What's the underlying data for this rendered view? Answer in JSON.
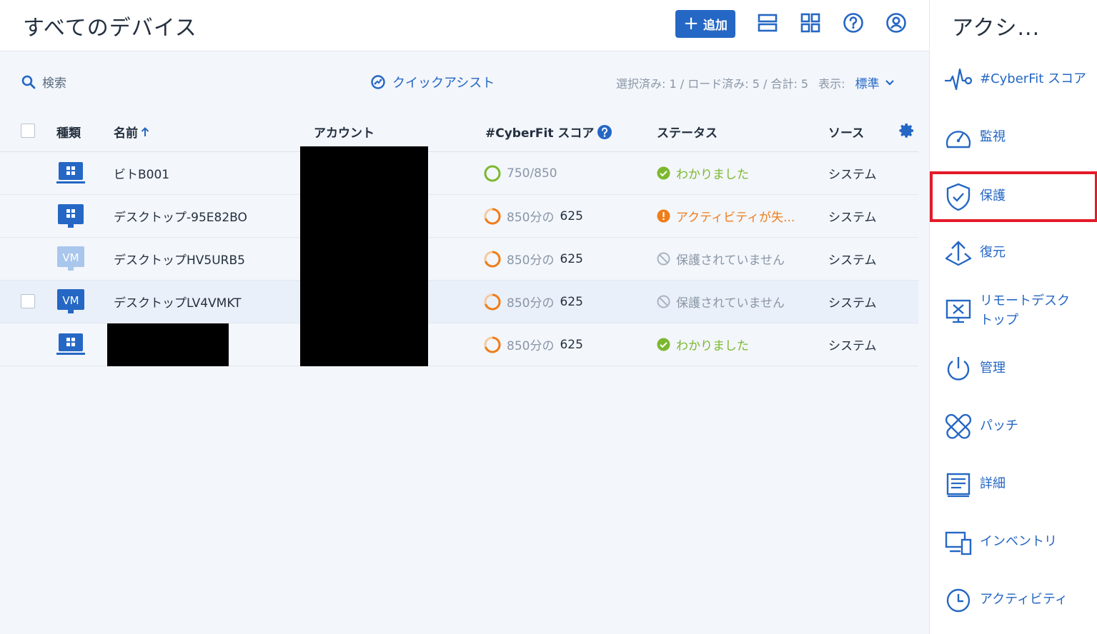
{
  "header": {
    "title": "すべてのデバイス",
    "add_label": "追加",
    "icons": [
      "list-view-icon",
      "grid-view-icon",
      "help-icon",
      "account-icon"
    ]
  },
  "toolbar": {
    "search_label": "検索",
    "quick_assist_label": "クイックアシスト",
    "stats": "選択済み: 1 / ロード済み: 5 / 合計: 5",
    "view_label": "表示:",
    "view_value": "標準"
  },
  "table": {
    "headers": {
      "type": "種類",
      "name": "名前",
      "account": "アカウント",
      "score": "#CyberFit スコア",
      "status": "ステータス",
      "source": "ソース"
    },
    "rows": [
      {
        "icon": "windows-device-icon",
        "name": "ビトB001",
        "score_text": "750/850",
        "score_value": "",
        "score_color": "#7cb82f",
        "status": "わかりました",
        "status_kind": "ok",
        "source": "システム"
      },
      {
        "icon": "windows-device-icon",
        "name": "デスクトップ-95E82BO",
        "score_text": "850分の",
        "score_value": "625",
        "score_color": "#ef7d1a",
        "status": "アクティビティが失...",
        "status_kind": "warn",
        "source": "システム"
      },
      {
        "icon": "vm-light-icon",
        "icon_text": "VM",
        "name": "デスクトップHV5URB5",
        "score_text": "850分の",
        "score_value": "625",
        "score_color": "#ef7d1a",
        "status": "保護されていません",
        "status_kind": "none",
        "source": "システム"
      },
      {
        "icon": "vm-icon",
        "icon_text": "VM",
        "name": "デスクトップLV4VMKT",
        "score_text": "850分の",
        "score_value": "625",
        "score_color": "#ef7d1a",
        "status": "保護されていません",
        "status_kind": "none",
        "source": "システム"
      },
      {
        "icon": "windows-device-icon",
        "name": "",
        "score_text": "850分の",
        "score_value": "625",
        "score_color": "#ef7d1a",
        "status": "わかりました",
        "status_kind": "ok",
        "source": "システム"
      }
    ]
  },
  "panel": {
    "title": "アクシ...",
    "actions": [
      {
        "label": "#CyberFit スコア",
        "icon": "pulse-icon"
      },
      {
        "label": "監視",
        "icon": "gauge-icon"
      },
      {
        "label": "保護",
        "icon": "shield-check-icon"
      },
      {
        "label": "復元",
        "icon": "restore-icon"
      },
      {
        "label": "リモートデスク\nトップ",
        "icon": "remote-desktop-icon"
      },
      {
        "label": "管理",
        "icon": "power-icon"
      },
      {
        "label": "パッチ",
        "icon": "patch-icon"
      },
      {
        "label": "詳細",
        "icon": "details-icon"
      },
      {
        "label": "インベントリ",
        "icon": "inventory-icon"
      },
      {
        "label": "アクティビティ",
        "icon": "clock-icon"
      }
    ]
  },
  "colors": {
    "accent": "#2567c4",
    "ok": "#7cb82f",
    "warn": "#ef7d1a",
    "highlight": "#e31a2a"
  }
}
